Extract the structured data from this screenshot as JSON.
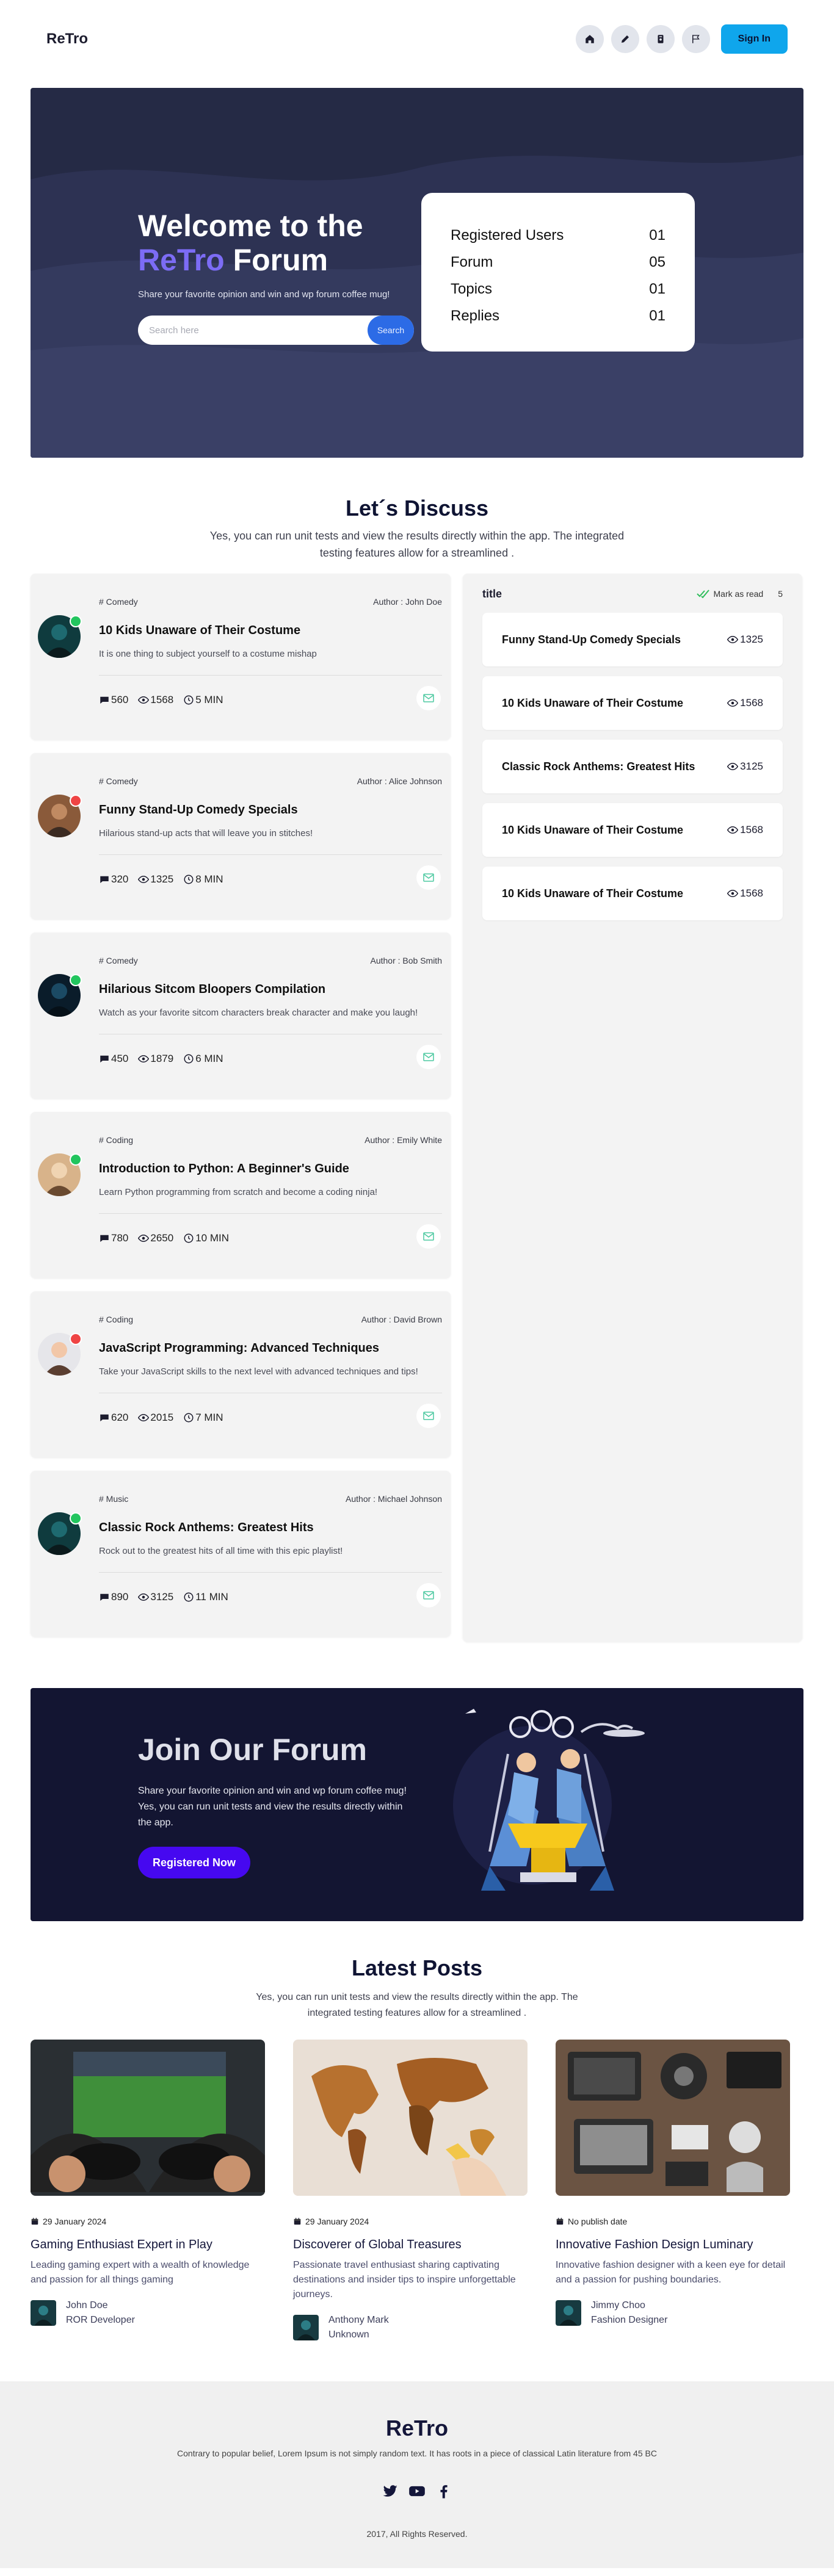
{
  "nav": {
    "logo": "ReTro",
    "icons": [
      "home-icon",
      "pencil-icon",
      "badge-icon",
      "flag-icon"
    ],
    "signin_label": "Sign In"
  },
  "hero": {
    "title_line1": "Welcome to the",
    "title_accent": "ReTro",
    "title_rest": " Forum",
    "subtitle": "Share your favorite opinion and win and wp forum coffee mug!",
    "search_placeholder": "Search here",
    "search_button": "Search",
    "stats": [
      {
        "label": "Registered Users",
        "value": "01"
      },
      {
        "label": "Forum",
        "value": "05"
      },
      {
        "label": "Topics",
        "value": "01"
      },
      {
        "label": "Replies",
        "value": "01"
      }
    ]
  },
  "discuss": {
    "title": "Let´s Discuss",
    "subtitle": "Yes, you can run unit tests and view the results directly within the app. The integrated testing features allow for a streamlined .",
    "cards": [
      {
        "category": "# Comedy",
        "author": "Author : John Doe",
        "title": "10 Kids Unaware of Their Costume",
        "desc": "It is one thing to subject yourself to a costume mishap",
        "comments": "560",
        "views": "1568",
        "time": "5 MIN",
        "status": "online",
        "status_color": "#22c55e",
        "avatar": "person-dark-avatar"
      },
      {
        "category": "# Comedy",
        "author": "Author : Alice Johnson",
        "title": "Funny Stand-Up Comedy Specials",
        "desc": "Hilarious stand-up acts that will leave you in stitches!",
        "comments": "320",
        "views": "1325",
        "time": "8 MIN",
        "status": "offline",
        "status_color": "#ef4444",
        "avatar": "person-bearded-avatar"
      },
      {
        "category": "# Comedy",
        "author": "Author : Bob Smith",
        "title": "Hilarious Sitcom Bloopers Compilation",
        "desc": "Watch as your favorite sitcom characters break character and make you laugh!",
        "comments": "450",
        "views": "1879",
        "time": "6 MIN",
        "status": "online",
        "status_color": "#22c55e",
        "avatar": "person-night-avatar"
      },
      {
        "category": "# Coding",
        "author": "Author : Emily White",
        "title": "Introduction to Python: A Beginner's Guide",
        "desc": "Learn Python programming from scratch and become a coding ninja!",
        "comments": "780",
        "views": "2650",
        "time": "10 MIN",
        "status": "online",
        "status_color": "#22c55e",
        "avatar": "person-smiling-avatar"
      },
      {
        "category": "# Coding",
        "author": "Author : David Brown",
        "title": "JavaScript Programming: Advanced Techniques",
        "desc": "Take your JavaScript skills to the next level with advanced techniques and tips!",
        "comments": "620",
        "views": "2015",
        "time": "7 MIN",
        "status": "offline",
        "status_color": "#ef4444",
        "avatar": "person-white-shirt-avatar"
      },
      {
        "category": "# Music",
        "author": "Author : Michael Johnson",
        "title": "Classic Rock Anthems: Greatest Hits",
        "desc": "Rock out to the greatest hits of all time with this epic playlist!",
        "comments": "890",
        "views": "3125",
        "time": "11 MIN",
        "status": "online",
        "status_color": "#22c55e",
        "avatar": "person-dark-avatar"
      }
    ]
  },
  "sidebar": {
    "title": "title",
    "mark_as_read": "Mark as read",
    "count": "5",
    "items": [
      {
        "title": "Funny Stand-Up Comedy Specials",
        "views": "1325"
      },
      {
        "title": "10 Kids Unaware of Their Costume",
        "views": "1568"
      },
      {
        "title": "Classic Rock Anthems: Greatest Hits",
        "views": "3125"
      },
      {
        "title": "10 Kids Unaware of Their Costume",
        "views": "1568"
      },
      {
        "title": "10 Kids Unaware of Their Costume",
        "views": "1568"
      }
    ]
  },
  "join": {
    "title": "Join Our Forum",
    "subtitle": "Share your favorite opinion and win and wp forum coffee mug! Yes, you can run unit tests and view the results directly within the app.",
    "button": "Registered Now"
  },
  "latest": {
    "title": "Latest Posts",
    "subtitle": "Yes, you can run unit tests and view the results directly within the app. The integrated testing features allow for a streamlined .",
    "posts": [
      {
        "date": "29 January 2024",
        "title": "Gaming Enthusiast Expert in Play",
        "desc": "Leading gaming expert with a wealth of knowledge and passion for all things gaming",
        "author_name": "John Doe",
        "author_role": "ROR Developer",
        "image": "gaming-controllers-photo"
      },
      {
        "date": "29 January 2024",
        "title": "Discoverer of Global Treasures",
        "desc": "Passionate travel enthusiast sharing captivating destinations and insider tips to inspire unforgettable journeys.",
        "author_name": "Anthony Mark",
        "author_role": "Unknown",
        "image": "world-map-photo"
      },
      {
        "date": "No publish date",
        "title": "Innovative Fashion Design Luminary",
        "desc": "Innovative fashion designer with a keen eye for detail and a passion for pushing boundaries.",
        "author_name": "Jimmy Choo",
        "author_role": "Fashion Designer",
        "image": "desk-workspace-photo"
      }
    ]
  },
  "footer": {
    "logo": "ReTro",
    "text": "Contrary to popular belief, Lorem Ipsum is not simply random text. It has roots in a piece of classical Latin literature from 45 BC",
    "social": [
      "twitter-icon",
      "youtube-icon",
      "facebook-icon"
    ],
    "copyright": "2017, All Rights Reserved."
  },
  "colors": {
    "accent": "#7c6cf5",
    "signin": "#0fa6ec",
    "hero_bg": "#252a45",
    "join_bg": "#131532",
    "join_button": "#4608f0"
  }
}
